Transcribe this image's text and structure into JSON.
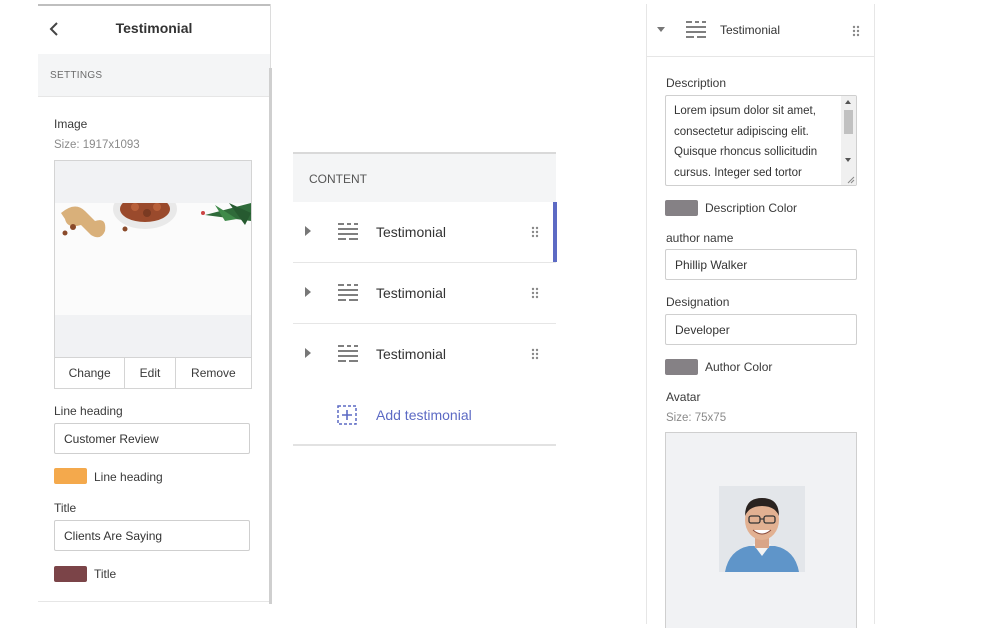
{
  "settings_panel": {
    "title": "Testimonial",
    "section_label": "SETTINGS",
    "image_label": "Image",
    "image_size": "Size: 1917x1093",
    "image_buttons": [
      "Change",
      "Edit",
      "Remove"
    ],
    "line_heading_label": "Line heading",
    "line_heading_value": "Customer Review",
    "line_heading_color_label": "Line heading",
    "line_heading_color": "#f4a94c",
    "title_label": "Title",
    "title_value": "Clients Are Saying",
    "title_color_label": "Title",
    "title_color": "#7b4448"
  },
  "content_panel": {
    "header": "CONTENT",
    "items": [
      {
        "label": "Testimonial"
      },
      {
        "label": "Testimonial"
      },
      {
        "label": "Testimonial"
      }
    ],
    "add_label": "Add testimonial",
    "accent_color": "#5c6ac4"
  },
  "block_panel": {
    "title": "Testimonial",
    "description_label": "Description",
    "description_value": "Lorem ipsum dolor sit amet, consectetur adipiscing elit. Quisque rhoncus sollicitudin cursus. Integer sed tortor",
    "description_color_label": "Description Color",
    "description_color": "#858185",
    "author_name_label": "author name",
    "author_name_value": "Phillip Walker",
    "designation_label": "Designation",
    "designation_value": "Developer",
    "author_color_label": "Author Color",
    "author_color": "#858185",
    "avatar_label": "Avatar",
    "avatar_size": "Size: 75x75"
  }
}
